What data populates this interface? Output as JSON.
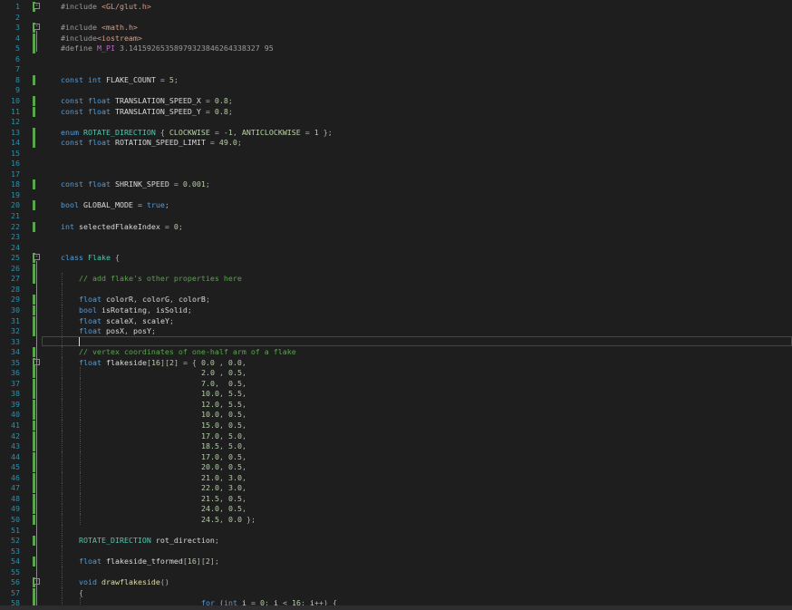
{
  "editor": {
    "lines": [
      {
        "n": "1",
        "ind": 0,
        "mod": true,
        "fold": "-",
        "tokens": [
          [
            "pp",
            "#include "
          ],
          [
            "str",
            "<GL/glut.h>"
          ]
        ]
      },
      {
        "n": "2",
        "ind": 0,
        "tokens": []
      },
      {
        "n": "3",
        "ind": 0,
        "mod": true,
        "fold": "-",
        "tokens": [
          [
            "pp",
            "#include "
          ],
          [
            "str",
            "<math.h>"
          ]
        ]
      },
      {
        "n": "4",
        "ind": 0,
        "mod": true,
        "tokens": [
          [
            "pp",
            "#include"
          ],
          [
            "str",
            "<iostream>"
          ]
        ]
      },
      {
        "n": "5",
        "ind": 0,
        "mod": true,
        "tokens": [
          [
            "pp",
            "#define "
          ],
          [
            "mac",
            "M_PI"
          ],
          [
            "pp",
            " 3.14159265358979323846264338327 95"
          ]
        ]
      },
      {
        "n": "6",
        "ind": 0,
        "tokens": []
      },
      {
        "n": "7",
        "ind": 0,
        "tokens": []
      },
      {
        "n": "8",
        "ind": 0,
        "mod": true,
        "tokens": [
          [
            "kw",
            "const "
          ],
          [
            "kw",
            "int "
          ],
          [
            "id",
            "FLAKE_COUNT "
          ],
          [
            "p",
            "= "
          ],
          [
            "num",
            "5"
          ],
          [
            "p",
            ";"
          ]
        ]
      },
      {
        "n": "9",
        "ind": 0,
        "tokens": []
      },
      {
        "n": "10",
        "ind": 0,
        "mod": true,
        "tokens": [
          [
            "kw",
            "const "
          ],
          [
            "kw",
            "float "
          ],
          [
            "id",
            "TRANSLATION_SPEED_X "
          ],
          [
            "p",
            "= "
          ],
          [
            "num",
            "0.8"
          ],
          [
            "p",
            ";"
          ]
        ]
      },
      {
        "n": "11",
        "ind": 0,
        "mod": true,
        "tokens": [
          [
            "kw",
            "const "
          ],
          [
            "kw",
            "float "
          ],
          [
            "id",
            "TRANSLATION_SPEED_Y "
          ],
          [
            "p",
            "= "
          ],
          [
            "num",
            "0.8"
          ],
          [
            "p",
            ";"
          ]
        ]
      },
      {
        "n": "12",
        "ind": 0,
        "tokens": []
      },
      {
        "n": "13",
        "ind": 0,
        "mod": true,
        "tokens": [
          [
            "kw",
            "enum "
          ],
          [
            "ty",
            "ROTATE_DIRECTION "
          ],
          [
            "p",
            "{ "
          ],
          [
            "en",
            "CLOCKWISE "
          ],
          [
            "p",
            "= "
          ],
          [
            "num",
            "-1"
          ],
          [
            "p",
            ", "
          ],
          [
            "en",
            "ANTICLOCKWISE "
          ],
          [
            "p",
            "= "
          ],
          [
            "num",
            "1 "
          ],
          [
            "p",
            "};"
          ]
        ]
      },
      {
        "n": "14",
        "ind": 0,
        "mod": true,
        "tokens": [
          [
            "kw",
            "const "
          ],
          [
            "kw",
            "float "
          ],
          [
            "id",
            "ROTATION_SPEED_LIMIT "
          ],
          [
            "p",
            "= "
          ],
          [
            "num",
            "49.0"
          ],
          [
            "p",
            ";"
          ]
        ]
      },
      {
        "n": "15",
        "ind": 0,
        "tokens": []
      },
      {
        "n": "16",
        "ind": 0,
        "tokens": []
      },
      {
        "n": "17",
        "ind": 0,
        "tokens": []
      },
      {
        "n": "18",
        "ind": 0,
        "mod": true,
        "tokens": [
          [
            "kw",
            "const "
          ],
          [
            "kw",
            "float "
          ],
          [
            "id",
            "SHRINK_SPEED "
          ],
          [
            "p",
            "= "
          ],
          [
            "num",
            "0.001"
          ],
          [
            "p",
            ";"
          ]
        ]
      },
      {
        "n": "19",
        "ind": 0,
        "tokens": []
      },
      {
        "n": "20",
        "ind": 0,
        "mod": true,
        "tokens": [
          [
            "kw",
            "bool "
          ],
          [
            "id",
            "GLOBAL_MODE "
          ],
          [
            "p",
            "= "
          ],
          [
            "kw",
            "true"
          ],
          [
            "p",
            ";"
          ]
        ]
      },
      {
        "n": "21",
        "ind": 0,
        "tokens": []
      },
      {
        "n": "22",
        "ind": 0,
        "mod": true,
        "tokens": [
          [
            "kw",
            "int "
          ],
          [
            "id",
            "selectedFlakeIndex "
          ],
          [
            "p",
            "= "
          ],
          [
            "num",
            "0"
          ],
          [
            "p",
            ";"
          ]
        ]
      },
      {
        "n": "23",
        "ind": 0,
        "tokens": []
      },
      {
        "n": "24",
        "ind": 0,
        "tokens": []
      },
      {
        "n": "25",
        "ind": 0,
        "mod": true,
        "fold": "-",
        "tokens": [
          [
            "kw",
            "class "
          ],
          [
            "ty",
            "Flake "
          ],
          [
            "p",
            "{"
          ]
        ]
      },
      {
        "n": "26",
        "ind": 0,
        "mod": true,
        "tokens": []
      },
      {
        "n": "27",
        "ind": 1,
        "mod": true,
        "tokens": [
          [
            "cm",
            "// add flake's other properties here"
          ]
        ]
      },
      {
        "n": "28",
        "ind": 1,
        "tokens": []
      },
      {
        "n": "29",
        "ind": 1,
        "mod": true,
        "tokens": [
          [
            "kw",
            "float "
          ],
          [
            "id",
            "colorR"
          ],
          [
            "p",
            ", "
          ],
          [
            "id",
            "colorG"
          ],
          [
            "p",
            ", "
          ],
          [
            "id",
            "colorB"
          ],
          [
            "p",
            ";"
          ]
        ]
      },
      {
        "n": "30",
        "ind": 1,
        "mod": true,
        "tokens": [
          [
            "kw",
            "bool "
          ],
          [
            "id",
            "isRotating"
          ],
          [
            "p",
            ", "
          ],
          [
            "id",
            "isSolid"
          ],
          [
            "p",
            ";"
          ]
        ]
      },
      {
        "n": "31",
        "ind": 1,
        "mod": true,
        "tokens": [
          [
            "kw",
            "float "
          ],
          [
            "id",
            "scaleX"
          ],
          [
            "p",
            ", "
          ],
          [
            "id",
            "scaleY"
          ],
          [
            "p",
            ";"
          ]
        ]
      },
      {
        "n": "32",
        "ind": 1,
        "mod": true,
        "tokens": [
          [
            "kw",
            "float "
          ],
          [
            "id",
            "posX"
          ],
          [
            "p",
            ", "
          ],
          [
            "id",
            "posY"
          ],
          [
            "p",
            ";"
          ]
        ]
      },
      {
        "n": "33",
        "ind": 1,
        "current": true,
        "tokens": []
      },
      {
        "n": "34",
        "ind": 1,
        "mod": true,
        "tokens": [
          [
            "cm",
            "// vertex coordinates of one-half arm of a flake"
          ]
        ]
      },
      {
        "n": "35",
        "ind": 1,
        "mod": true,
        "fold": "-",
        "tokens": [
          [
            "kw",
            "float "
          ],
          [
            "id",
            "flakeside"
          ],
          [
            "p",
            "["
          ],
          [
            "num",
            "16"
          ],
          [
            "p",
            "]["
          ],
          [
            "num",
            "2"
          ],
          [
            "p",
            "] = { "
          ],
          [
            "num",
            "0.0 "
          ],
          [
            "p",
            ", "
          ],
          [
            "num",
            "0.0"
          ],
          [
            "p",
            ","
          ]
        ]
      },
      {
        "n": "36",
        "ind": 2,
        "mod": true,
        "tokens": [
          [
            "num",
            "2.0 "
          ],
          [
            "p",
            ", "
          ],
          [
            "num",
            "0.5"
          ],
          [
            "p",
            ","
          ]
        ]
      },
      {
        "n": "37",
        "ind": 2,
        "mod": true,
        "tokens": [
          [
            "num",
            "7.0"
          ],
          [
            "p",
            ",  "
          ],
          [
            "num",
            "0.5"
          ],
          [
            "p",
            ","
          ]
        ]
      },
      {
        "n": "38",
        "ind": 2,
        "mod": true,
        "tokens": [
          [
            "num",
            "10.0"
          ],
          [
            "p",
            ", "
          ],
          [
            "num",
            "5.5"
          ],
          [
            "p",
            ","
          ]
        ]
      },
      {
        "n": "39",
        "ind": 2,
        "mod": true,
        "tokens": [
          [
            "num",
            "12.0"
          ],
          [
            "p",
            ", "
          ],
          [
            "num",
            "5.5"
          ],
          [
            "p",
            ","
          ]
        ]
      },
      {
        "n": "40",
        "ind": 2,
        "mod": true,
        "tokens": [
          [
            "num",
            "10.0"
          ],
          [
            "p",
            ", "
          ],
          [
            "num",
            "0.5"
          ],
          [
            "p",
            ","
          ]
        ]
      },
      {
        "n": "41",
        "ind": 2,
        "mod": true,
        "tokens": [
          [
            "num",
            "15.0"
          ],
          [
            "p",
            ", "
          ],
          [
            "num",
            "0.5"
          ],
          [
            "p",
            ","
          ]
        ]
      },
      {
        "n": "42",
        "ind": 2,
        "mod": true,
        "tokens": [
          [
            "num",
            "17.0"
          ],
          [
            "p",
            ", "
          ],
          [
            "num",
            "5.0"
          ],
          [
            "p",
            ","
          ]
        ]
      },
      {
        "n": "43",
        "ind": 2,
        "mod": true,
        "tokens": [
          [
            "num",
            "18.5"
          ],
          [
            "p",
            ", "
          ],
          [
            "num",
            "5.0"
          ],
          [
            "p",
            ","
          ]
        ]
      },
      {
        "n": "44",
        "ind": 2,
        "mod": true,
        "tokens": [
          [
            "num",
            "17.0"
          ],
          [
            "p",
            ", "
          ],
          [
            "num",
            "0.5"
          ],
          [
            "p",
            ","
          ]
        ]
      },
      {
        "n": "45",
        "ind": 2,
        "mod": true,
        "tokens": [
          [
            "num",
            "20.0"
          ],
          [
            "p",
            ", "
          ],
          [
            "num",
            "0.5"
          ],
          [
            "p",
            ","
          ]
        ]
      },
      {
        "n": "46",
        "ind": 2,
        "mod": true,
        "tokens": [
          [
            "num",
            "21.0"
          ],
          [
            "p",
            ", "
          ],
          [
            "num",
            "3.0"
          ],
          [
            "p",
            ","
          ]
        ]
      },
      {
        "n": "47",
        "ind": 2,
        "mod": true,
        "tokens": [
          [
            "num",
            "22.0"
          ],
          [
            "p",
            ", "
          ],
          [
            "num",
            "3.0"
          ],
          [
            "p",
            ","
          ]
        ]
      },
      {
        "n": "48",
        "ind": 2,
        "mod": true,
        "tokens": [
          [
            "num",
            "21.5"
          ],
          [
            "p",
            ", "
          ],
          [
            "num",
            "0.5"
          ],
          [
            "p",
            ","
          ]
        ]
      },
      {
        "n": "49",
        "ind": 2,
        "mod": true,
        "tokens": [
          [
            "num",
            "24.0"
          ],
          [
            "p",
            ", "
          ],
          [
            "num",
            "0.5"
          ],
          [
            "p",
            ","
          ]
        ]
      },
      {
        "n": "50",
        "ind": 2,
        "mod": true,
        "tokens": [
          [
            "num",
            "24.5"
          ],
          [
            "p",
            ", "
          ],
          [
            "num",
            "0.0 "
          ],
          [
            "p",
            "};"
          ]
        ]
      },
      {
        "n": "51",
        "ind": 1,
        "tokens": []
      },
      {
        "n": "52",
        "ind": 1,
        "mod": true,
        "tokens": [
          [
            "ty",
            "ROTATE_DIRECTION "
          ],
          [
            "id",
            "rot_direction"
          ],
          [
            "p",
            ";"
          ]
        ]
      },
      {
        "n": "53",
        "ind": 1,
        "tokens": []
      },
      {
        "n": "54",
        "ind": 1,
        "mod": true,
        "tokens": [
          [
            "kw",
            "float "
          ],
          [
            "id",
            "flakeside_tformed"
          ],
          [
            "p",
            "["
          ],
          [
            "num",
            "16"
          ],
          [
            "p",
            "]["
          ],
          [
            "num",
            "2"
          ],
          [
            "p",
            "];"
          ]
        ]
      },
      {
        "n": "55",
        "ind": 1,
        "tokens": []
      },
      {
        "n": "56",
        "ind": 1,
        "mod": true,
        "fold": "-",
        "tokens": [
          [
            "kw",
            "void "
          ],
          [
            "fn",
            "drawflakeside"
          ],
          [
            "p",
            "()"
          ]
        ]
      },
      {
        "n": "57",
        "ind": 1,
        "mod": true,
        "tokens": [
          [
            "p",
            "{"
          ]
        ]
      },
      {
        "n": "58",
        "ind": 2,
        "mod": true,
        "tokens": [
          [
            "kw",
            "for "
          ],
          [
            "p",
            "("
          ],
          [
            "kw",
            "int "
          ],
          [
            "id",
            "i "
          ],
          [
            "p",
            "= "
          ],
          [
            "num",
            "0"
          ],
          [
            "p",
            "; "
          ],
          [
            "id",
            "i "
          ],
          [
            "p",
            "< "
          ],
          [
            "num",
            "16"
          ],
          [
            "p",
            "; "
          ],
          [
            "id",
            "i"
          ],
          [
            "p",
            "++) {"
          ]
        ]
      }
    ]
  },
  "colors": {
    "background": "#1e1e1e",
    "line_number": "#2b91af",
    "modified_bar": "#57a64a"
  }
}
